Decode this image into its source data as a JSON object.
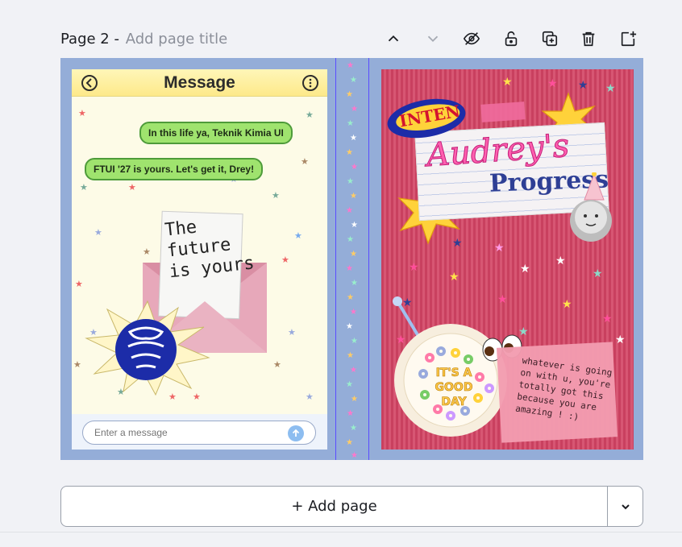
{
  "page_header": {
    "page_number": "Page 2 - ",
    "title_placeholder": "Add page title"
  },
  "toolbar": {
    "icons": [
      "chevron-up-icon",
      "chevron-down-icon",
      "eye-off-icon",
      "lock-icon",
      "duplicate-icon",
      "trash-icon",
      "add-page-icon"
    ]
  },
  "phone": {
    "title": "Message",
    "bubbles": [
      "In this life ya, Teknik Kimia UI",
      "FTUI '27 is yours. Let's get it, Drey!"
    ],
    "note_text": [
      "The",
      "future",
      "is yours"
    ],
    "input_placeholder": "Enter a message"
  },
  "poster": {
    "badge_text": "INTEN",
    "script_title": "Audrey's",
    "bold_title": "Progress",
    "cereal_text": [
      "IT'S A",
      "GOOD DAY"
    ],
    "sticky_note": "whatever is going on with u, you're totally got this because you are amazing ! :)"
  },
  "add_page": {
    "label": "+ Add page"
  },
  "colors": {
    "canvas_bg": "#94add8",
    "poster_pink": "#c9405f",
    "bubble_green": "#9fe36e",
    "accent_pink": "#ff5fb0",
    "title_blue": "#2e3f95"
  }
}
